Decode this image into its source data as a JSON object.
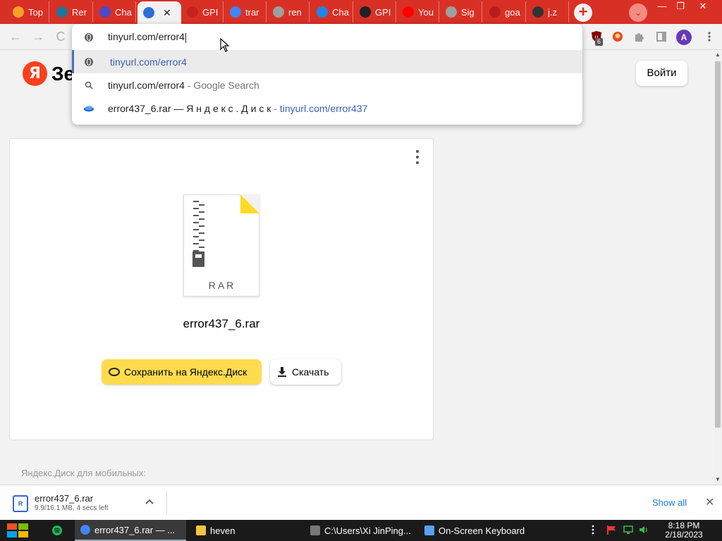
{
  "colors": {
    "brand_red": "#d93025",
    "yandex_red": "#fc3f1d",
    "save_yellow": "#ffdb4d",
    "link_blue": "#3c5fb4",
    "file_corner_yellow": "#ffdb26"
  },
  "browser": {
    "tabs": [
      {
        "title": "Top",
        "icon": "yandex-icon",
        "color": "#f4a12a"
      },
      {
        "title": "Rer",
        "icon": "wordpress-icon",
        "color": "#21759b"
      },
      {
        "title": "Cha",
        "icon": "app-icon",
        "color": "#4a4acb"
      },
      {
        "title": "",
        "icon": "yandex-disk-icon",
        "color": "#2b6fd6"
      },
      {
        "title": "GPI",
        "icon": "gmail-icon",
        "color": "#c5221f"
      },
      {
        "title": "trar",
        "icon": "google-icon",
        "color": "#4285f4"
      },
      {
        "title": "ren",
        "icon": "globe-icon",
        "color": "#9e9e9e"
      },
      {
        "title": "Cha",
        "icon": "app-icon",
        "color": "#1e88e5"
      },
      {
        "title": "GPI",
        "icon": "google-icon",
        "color": "#202124"
      },
      {
        "title": "You",
        "icon": "youtube-icon",
        "color": "#ff0000"
      },
      {
        "title": "Sig",
        "icon": "globe-icon",
        "color": "#9e9e9e"
      },
      {
        "title": "goa",
        "icon": "flag-icon",
        "color": "#b71c1c"
      },
      {
        "title": "j.z",
        "icon": "anime-icon",
        "color": "#333333"
      }
    ],
    "active_tab_index": 3,
    "new_tab_label": "+",
    "tab_search_label": "⌄",
    "window_buttons": {
      "minimize": "—",
      "restore": "❐",
      "close": "✕"
    },
    "toolbar": {
      "back": "←",
      "forward": "→",
      "reload": "C",
      "extension_badge": "6",
      "profile_initial": "A"
    },
    "omnibox": {
      "input_value": "tinyurl.com/error4",
      "suggestions": [
        {
          "type": "url",
          "url": "tinyurl.com/error4",
          "icon": "globe-icon"
        },
        {
          "type": "search",
          "query": "tinyurl.com/error4",
          "suffix": " - Google Search",
          "icon": "search-icon"
        },
        {
          "type": "history",
          "title": "error437_6.rar — Я н д е к с . Д и с к",
          "separator": " - ",
          "url": "tinyurl.com/error437",
          "icon": "yandex-disk-icon"
        }
      ]
    }
  },
  "page": {
    "logo_letter": "Я",
    "logo_text": "Зе",
    "login_label": "Войти",
    "file": {
      "type_label": "RAR",
      "name": "error437_6.rar"
    },
    "save_label": "Сохранить на Яндекс.Диск",
    "download_label": "Скачать",
    "mobile_text": "Яндекс.Диск для мобильных:"
  },
  "download_shelf": {
    "item_name": "error437_6.rar",
    "item_status": "9.9/16.1 MB, 4 secs left",
    "show_all": "Show all",
    "close": "✕"
  },
  "taskbar": {
    "tasks": [
      {
        "label": "error437_6.rar — ...",
        "icon": "chrome-icon",
        "active": true
      },
      {
        "label": "heven",
        "icon": "folder-icon",
        "active": false
      },
      {
        "label": "C:\\Users\\Xi JinPing...",
        "icon": "archive-icon",
        "active": false
      },
      {
        "label": "On-Screen Keyboard",
        "icon": "keyboard-icon",
        "active": false
      }
    ],
    "time": "8:18 PM",
    "date": "2/18/2023"
  }
}
